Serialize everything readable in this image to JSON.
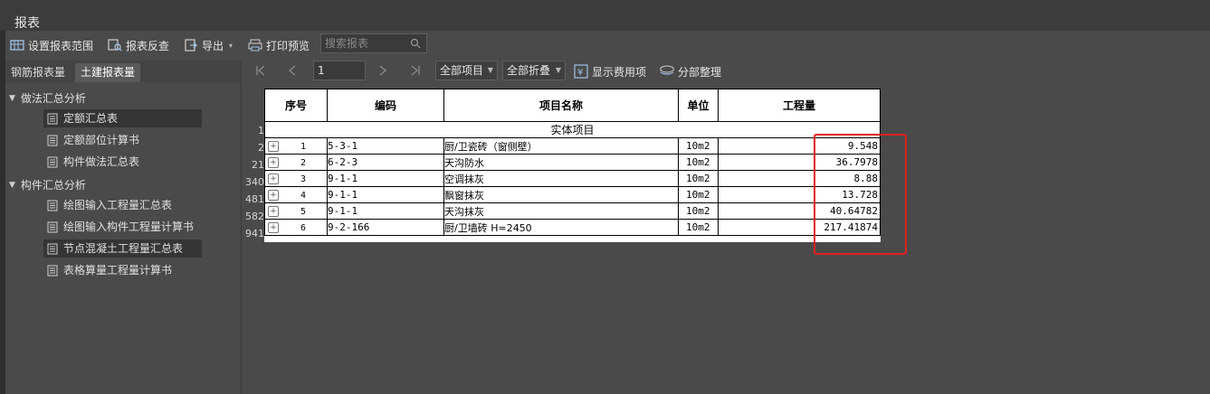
{
  "window": {
    "title": "报表"
  },
  "toolbar": {
    "set_range": "设置报表范围",
    "report_check": "报表反查",
    "export": "导出",
    "print_preview": "打印预览",
    "search_placeholder": "搜索报表"
  },
  "left_tabs": [
    "钢筋报表量",
    "土建报表量"
  ],
  "tree": {
    "groups": [
      {
        "label": "做法汇总分析",
        "items": [
          "定额汇总表",
          "定额部位计算书",
          "构件做法汇总表"
        ]
      },
      {
        "label": "构件汇总分析",
        "items": [
          "绘图输入工程量汇总表",
          "绘图输入构件工程量计算书",
          "节点混凝土工程量汇总表",
          "表格算量工程量计算书"
        ]
      }
    ]
  },
  "report_toolbar": {
    "page": "1",
    "all_items": "全部项目",
    "collapse_all": "全部折叠",
    "show_cost": "显示费用项",
    "section_arrange": "分部整理"
  },
  "report": {
    "headers": [
      "序号",
      "编码",
      "项目名称",
      "单位",
      "工程量"
    ],
    "section_title": "实体项目",
    "row_numbers": [
      "1",
      "2",
      "21",
      "340",
      "481",
      "582",
      "941"
    ],
    "rows": [
      {
        "seq": "1",
        "code": "5-3-1",
        "name": "厨/卫瓷砖（窗侧壁）",
        "unit": "10m2",
        "qty": "9.548"
      },
      {
        "seq": "2",
        "code": "6-2-3",
        "name": "天沟防水",
        "unit": "10m2",
        "qty": "36.7978"
      },
      {
        "seq": "3",
        "code": "9-1-1",
        "name": "空调抹灰",
        "unit": "10m2",
        "qty": "8.88"
      },
      {
        "seq": "4",
        "code": "9-1-1",
        "name": "飘窗抹灰",
        "unit": "10m2",
        "qty": "13.728"
      },
      {
        "seq": "5",
        "code": "9-1-1",
        "name": "天沟抹灰",
        "unit": "10m2",
        "qty": "40.64782"
      },
      {
        "seq": "6",
        "code": "9-2-166",
        "name": "厨/卫墙砖 H=2450",
        "unit": "10m2",
        "qty": "217.41874"
      }
    ]
  },
  "colors": {
    "highlight": "#e02020",
    "background": "#4a4a4a"
  }
}
